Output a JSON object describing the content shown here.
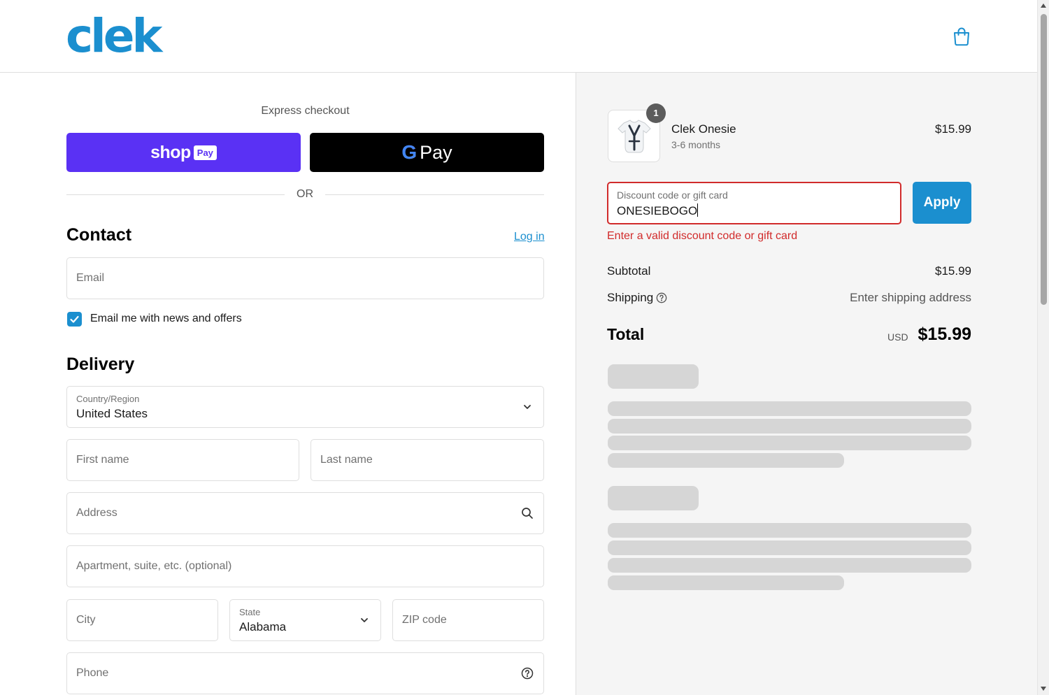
{
  "header": {
    "logo_text": "clek",
    "cart_icon": "cart-icon"
  },
  "express": {
    "title": "Express checkout",
    "shop_pay_word": "shop",
    "shop_pay_pill": "Pay",
    "gpay_g": "G",
    "gpay_pay": "Pay",
    "or_text": "OR"
  },
  "contact": {
    "title": "Contact",
    "login_label": "Log in",
    "email_placeholder": "Email",
    "newsletter_label": "Email me with news and offers",
    "newsletter_checked": true
  },
  "delivery": {
    "title": "Delivery",
    "country_label": "Country/Region",
    "country_value": "United States",
    "first_name_placeholder": "First name",
    "last_name_placeholder": "Last name",
    "address_placeholder": "Address",
    "apartment_placeholder": "Apartment, suite, etc. (optional)",
    "city_placeholder": "City",
    "state_label": "State",
    "state_value": "Alabama",
    "zip_placeholder": "ZIP code",
    "phone_placeholder": "Phone"
  },
  "summary": {
    "product": {
      "quantity": "1",
      "name": "Clek Onesie",
      "variant": "3-6 months",
      "price": "$15.99"
    },
    "discount": {
      "label": "Discount code or gift card",
      "value": "ONESIEBOGO",
      "apply_label": "Apply",
      "error": "Enter a valid discount code or gift card"
    },
    "subtotal_label": "Subtotal",
    "subtotal_value": "$15.99",
    "shipping_label": "Shipping",
    "shipping_value": "Enter shipping address",
    "total_label": "Total",
    "total_currency": "USD",
    "total_value": "$15.99"
  },
  "colors": {
    "accent": "#1b8fcf",
    "shop_pay": "#5a31f4",
    "error": "#d12b2b",
    "summary_bg": "#f5f5f5"
  }
}
